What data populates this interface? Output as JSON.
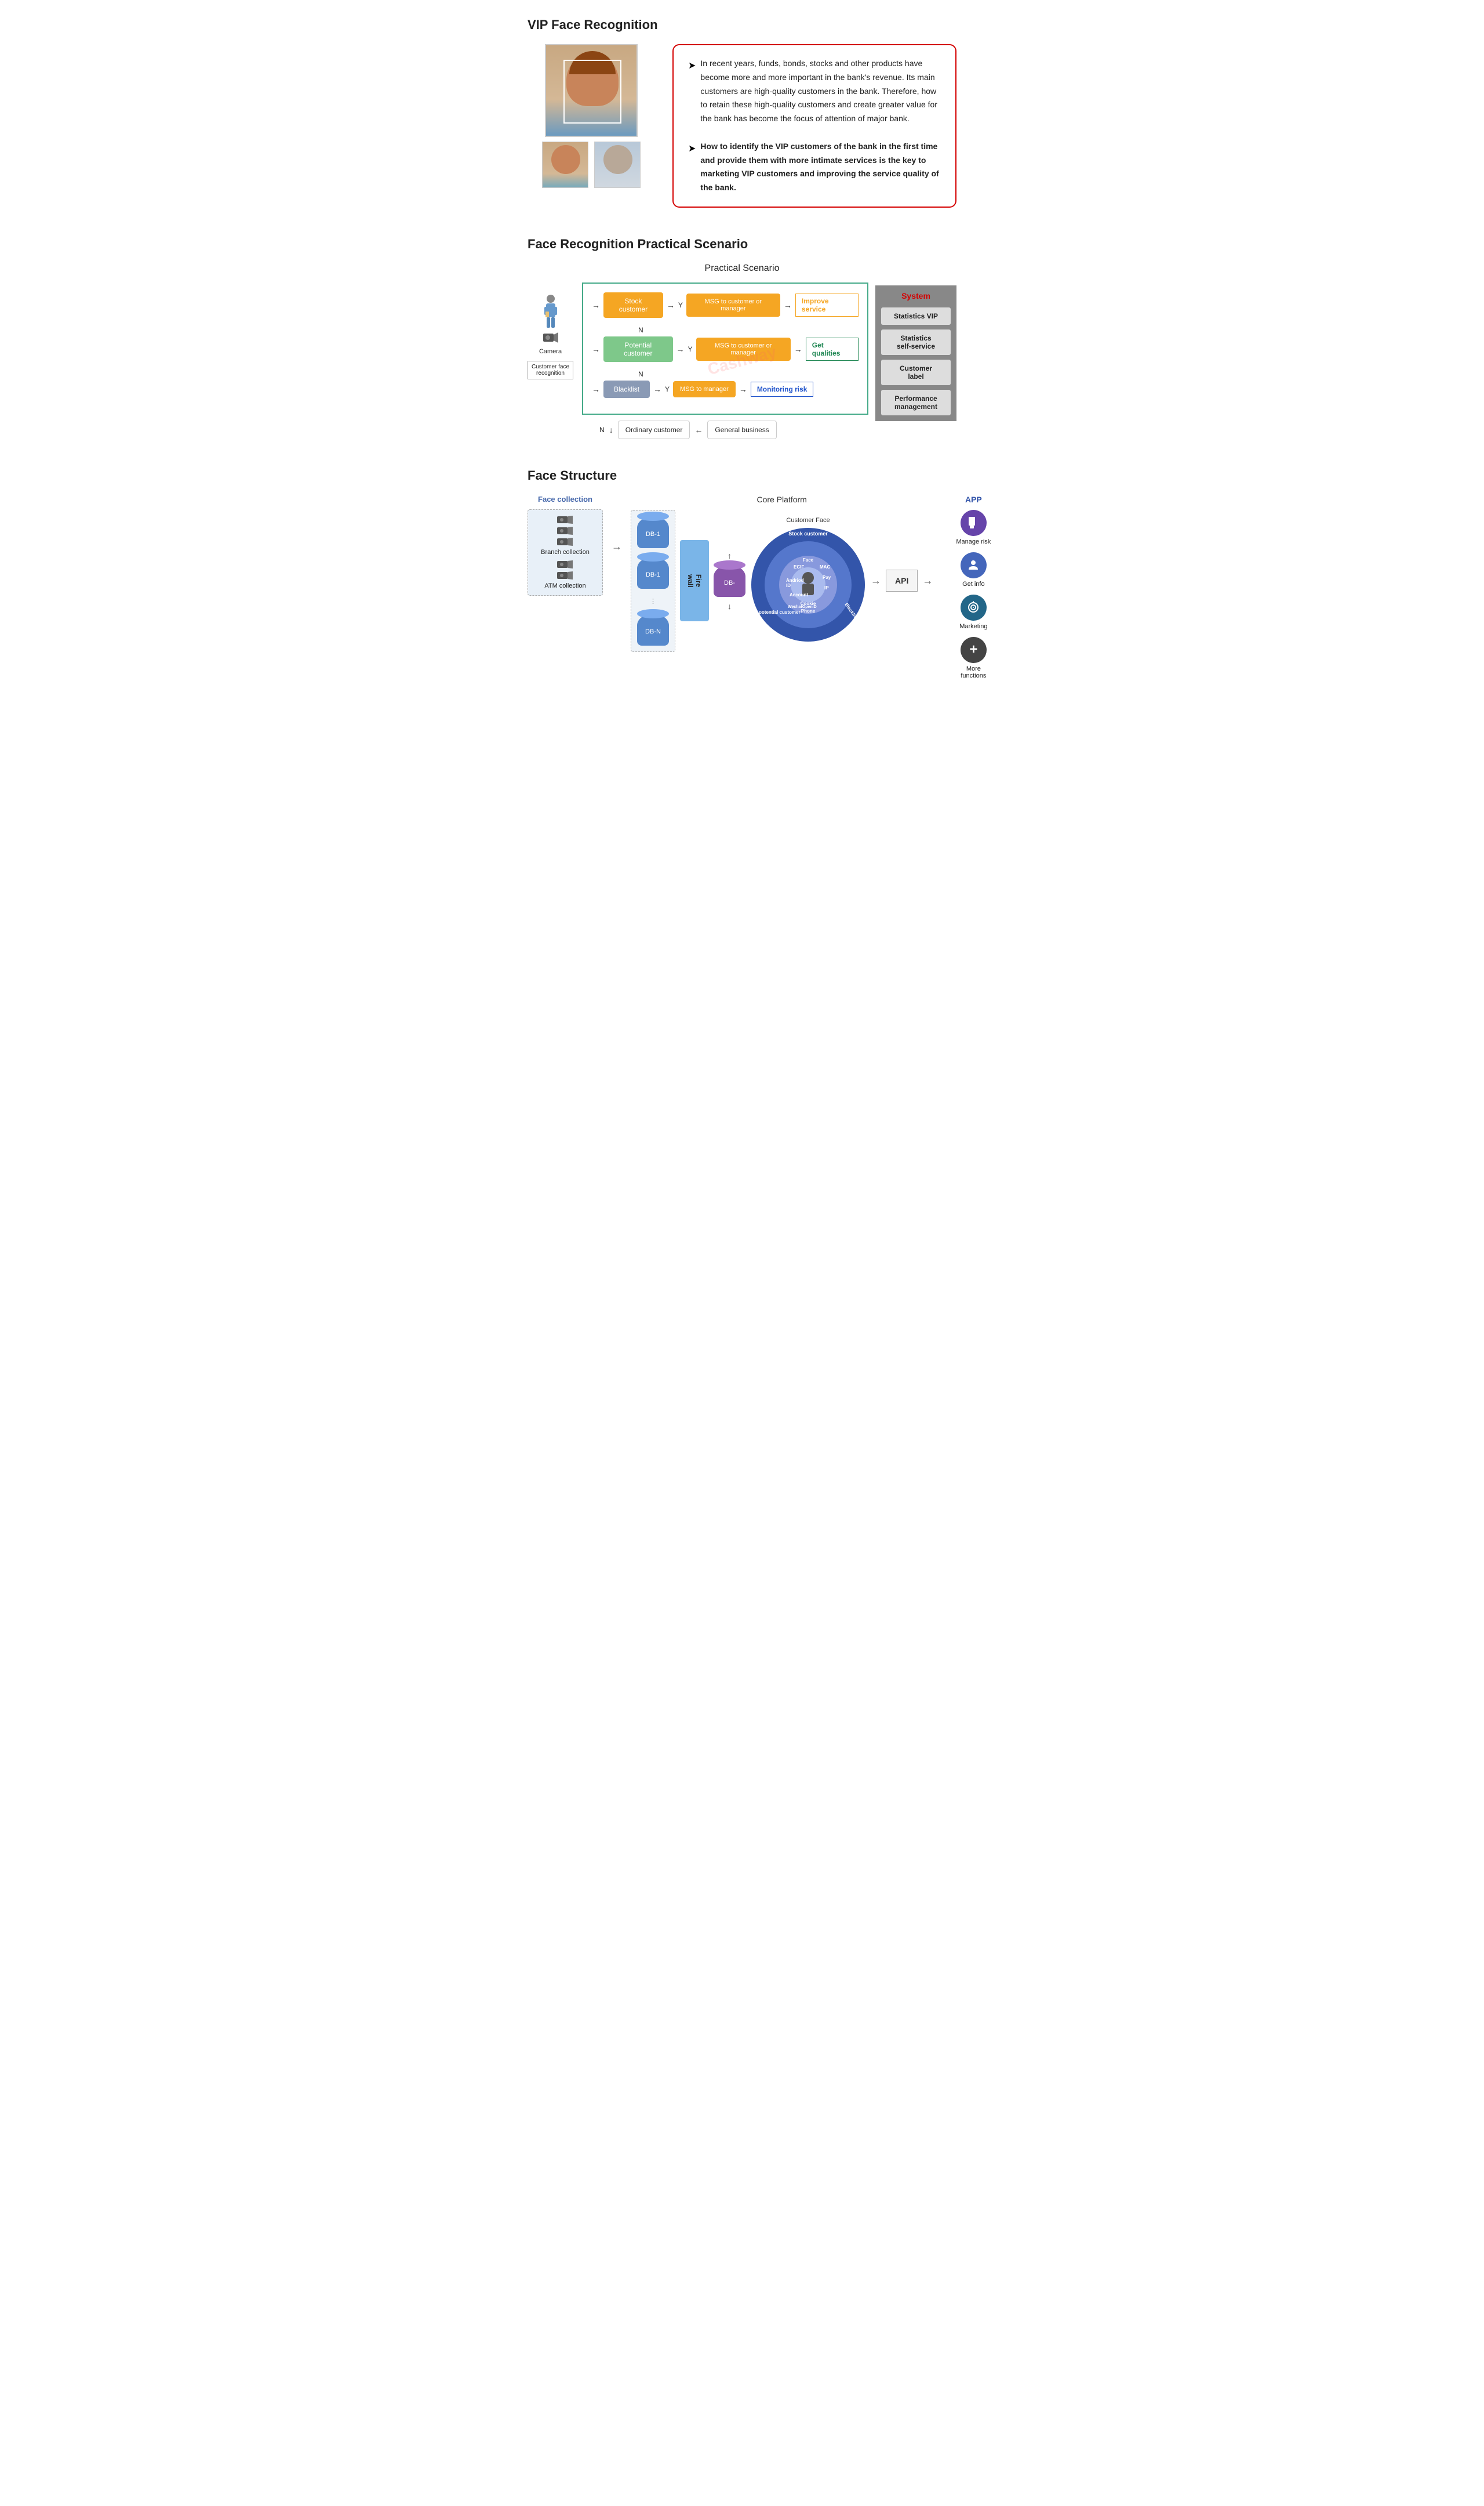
{
  "section1": {
    "title": "VIP Face Recognition",
    "bullet1": "In recent years, funds, bonds, stocks and other products have become more and more important in the bank's revenue. Its main customers are high-quality customers in the bank. Therefore, how to retain these high-quality customers and create greater value for the bank has become the focus of attention of major bank.",
    "bullet2": "How to identify the VIP customers of the bank in the first time and provide them with more intimate services is the key to marketing VIP customers and improving the service quality of the bank."
  },
  "section2": {
    "title": "Face Recognition Practical Scenario",
    "subtitle": "Practical Scenario",
    "labels": {
      "camera": "Camera",
      "face_recog": "Customer face\nrecognition",
      "stock": "Stock customer",
      "potential": "Potential customer",
      "blacklist": "Blacklist",
      "msg1": "MSG to customer or\nmanager",
      "msg2": "MSG to customer or\nmanager",
      "msg3": "MSG to manager",
      "improve": "Improve service",
      "get_qualities": "Get qualities",
      "monitoring": "Monitoring risk",
      "y1": "Y",
      "y2": "Y",
      "y3": "Y",
      "n1": "N",
      "n2": "N",
      "n_bottom": "N",
      "general": "General business",
      "ordinary": "Ordinary customer",
      "system_title": "System",
      "stats_vip": "Statistics VIP",
      "stats_self": "Statistics\nself-service",
      "customer_label": "Customer\nlabel",
      "perf_mgmt": "Performance\nmanagement"
    },
    "watermark": "Cashway"
  },
  "section3": {
    "title": "Face Structure",
    "face_collection": "Face collection",
    "core_platform": "Core Platform",
    "app_label": "APP",
    "db1_label": "DB-1",
    "db1b_label": "DB-1",
    "db_minus": "DB-",
    "dbn_label": "DB-N",
    "firewall": "Fire\nwall",
    "api_label": "API",
    "branch_collection": "Branch collection",
    "atm_collection": "ATM collection",
    "customer_face_label": "Customer Face",
    "stock_customer": "Stock customer",
    "potential_customer": "potential customer",
    "blacklist_label": "Blacklist",
    "inner_labels": [
      "ECIF",
      "Face",
      "MAC",
      "Andriod\nID",
      "Pay",
      "IP",
      "Account",
      "Cookie",
      "Phone",
      "WechatOpenID"
    ],
    "app_items": [
      {
        "label": "Manage risk",
        "icon": "📱"
      },
      {
        "label": "Get info",
        "icon": "👤"
      },
      {
        "label": "Marketing",
        "icon": "🎯"
      },
      {
        "label": "More\nfunctions",
        "icon": "+"
      }
    ]
  }
}
